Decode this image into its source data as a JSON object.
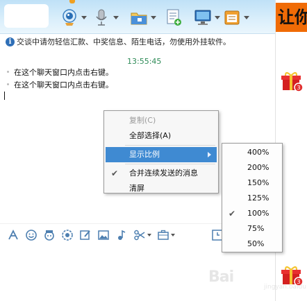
{
  "toolbar": {
    "icons": [
      "webcam-icon",
      "microphone-icon",
      "folder-icon",
      "document-icon",
      "monitor-icon",
      "calendar-icon"
    ]
  },
  "notice": {
    "icon": "i",
    "text": "交谈中请勿轻信汇款、中奖信息、陌生电话，勿使用外挂软件。"
  },
  "chat": {
    "timestamp": "13:55:45",
    "messages": [
      "在这个聊天窗口内点击右键。",
      "在这个聊天窗口内点击右键。"
    ]
  },
  "context_menu": {
    "items": [
      {
        "label": "复制(C)",
        "enabled": false
      },
      {
        "label": "全部选择(A)",
        "enabled": true
      },
      {
        "label": "显示比例",
        "enabled": true,
        "has_submenu": true,
        "highlighted": true
      },
      {
        "label": "合并连续发送的消息",
        "enabled": true,
        "checked": true
      },
      {
        "label": "清屏",
        "enabled": true
      }
    ]
  },
  "zoom_submenu": {
    "options": [
      "400%",
      "200%",
      "150%",
      "125%",
      "100%",
      "75%",
      "50%"
    ],
    "selected": "100%"
  },
  "sidebar": {
    "banner_text": "让你"
  },
  "watermark": {
    "text": "Bai",
    "sub": "jingyan.baidu.com"
  },
  "colors": {
    "toolbar_bg": "#d9eefb",
    "menu_highlight": "#3f8ad2",
    "timestamp": "#2e8b57",
    "banner": "#f06b06"
  }
}
